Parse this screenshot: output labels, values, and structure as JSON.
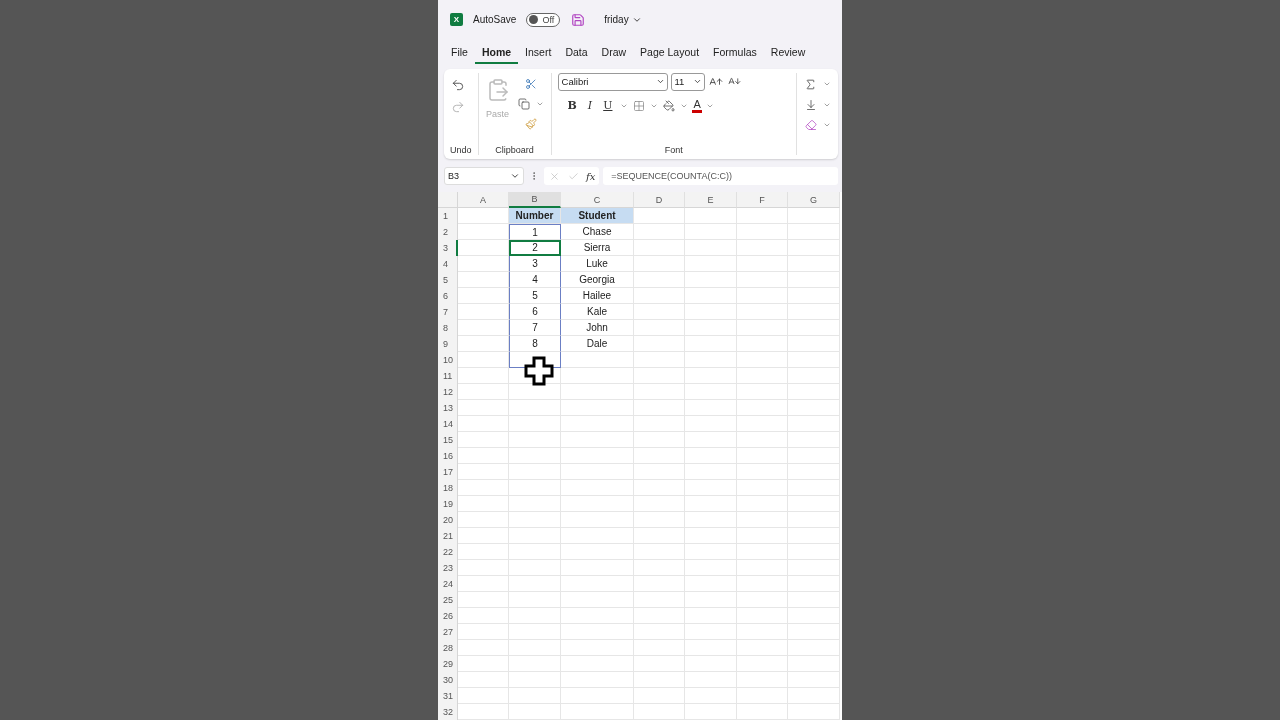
{
  "title_bar": {
    "logo": "X",
    "autosave_label": "AutoSave",
    "autosave": {
      "on": false,
      "label": "Off"
    },
    "file_name": "friday"
  },
  "ribbon_tabs": [
    {
      "label": "File",
      "selected": false
    },
    {
      "label": "Home",
      "selected": true
    },
    {
      "label": "Insert",
      "selected": false
    },
    {
      "label": "Data",
      "selected": false
    },
    {
      "label": "Draw",
      "selected": false
    },
    {
      "label": "Page Layout",
      "selected": false
    },
    {
      "label": "Formulas",
      "selected": false
    },
    {
      "label": "Review",
      "selected": false
    }
  ],
  "ribbon": {
    "undo_group": "Undo",
    "clipboard_group": "Clipboard",
    "font_group": "Font",
    "paste_label": "Paste",
    "font_name": "Calibri",
    "font_size": "11",
    "bold": "B",
    "italic": "I",
    "underline": "U",
    "font_color": "A"
  },
  "formula_bar": {
    "name_box": "B3",
    "fx": "fx",
    "formula": "=SEQUENCE(COUNTA(C:C))"
  },
  "columns": [
    {
      "label": "A",
      "selected": false
    },
    {
      "label": "B",
      "selected": true
    },
    {
      "label": "C",
      "selected": false
    },
    {
      "label": "D",
      "selected": false
    },
    {
      "label": "E",
      "selected": false
    },
    {
      "label": "F",
      "selected": false
    },
    {
      "label": "G",
      "selected": false
    }
  ],
  "rows": [
    {
      "label": "1",
      "kind": "header",
      "selected": false,
      "in_range": false,
      "b": "Number",
      "c": "Student"
    },
    {
      "label": "2",
      "kind": "data",
      "selected": false,
      "in_range": true,
      "b": "1",
      "c": "Chase"
    },
    {
      "label": "3",
      "kind": "data",
      "selected": true,
      "in_range": true,
      "b": "2",
      "c": "Sierra"
    },
    {
      "label": "4",
      "kind": "data",
      "selected": false,
      "in_range": true,
      "b": "3",
      "c": "Luke"
    },
    {
      "label": "5",
      "kind": "data",
      "selected": false,
      "in_range": true,
      "b": "4",
      "c": "Georgia"
    },
    {
      "label": "6",
      "kind": "data",
      "selected": false,
      "in_range": true,
      "b": "5",
      "c": "Hailee"
    },
    {
      "label": "7",
      "kind": "data",
      "selected": false,
      "in_range": true,
      "b": "6",
      "c": "Kale"
    },
    {
      "label": "8",
      "kind": "data",
      "selected": false,
      "in_range": true,
      "b": "7",
      "c": "John"
    },
    {
      "label": "9",
      "kind": "data",
      "selected": false,
      "in_range": true,
      "b": "8",
      "c": "Dale"
    },
    {
      "label": "10",
      "kind": "data",
      "selected": false,
      "in_range": true
    },
    {
      "label": "11",
      "kind": "data",
      "selected": false,
      "in_range": false
    },
    {
      "label": "12",
      "kind": "data",
      "selected": false,
      "in_range": false
    },
    {
      "label": "13",
      "kind": "data",
      "selected": false,
      "in_range": false
    },
    {
      "label": "14",
      "kind": "data",
      "selected": false,
      "in_range": false
    },
    {
      "label": "15",
      "kind": "data",
      "selected": false,
      "in_range": false
    },
    {
      "label": "16",
      "kind": "data",
      "selected": false,
      "in_range": false
    },
    {
      "label": "17",
      "kind": "data",
      "selected": false,
      "in_range": false
    },
    {
      "label": "18",
      "kind": "data",
      "selected": false,
      "in_range": false
    },
    {
      "label": "19",
      "kind": "data",
      "selected": false,
      "in_range": false
    },
    {
      "label": "20",
      "kind": "data",
      "selected": false,
      "in_range": false
    },
    {
      "label": "21",
      "kind": "data",
      "selected": false,
      "in_range": false
    },
    {
      "label": "22",
      "kind": "data",
      "selected": false,
      "in_range": false
    },
    {
      "label": "23",
      "kind": "data",
      "selected": false,
      "in_range": false
    },
    {
      "label": "24",
      "kind": "data",
      "selected": false,
      "in_range": false
    },
    {
      "label": "25",
      "kind": "data",
      "selected": false,
      "in_range": false
    },
    {
      "label": "26",
      "kind": "data",
      "selected": false,
      "in_range": false
    },
    {
      "label": "27",
      "kind": "data",
      "selected": false,
      "in_range": false
    },
    {
      "label": "28",
      "kind": "data",
      "selected": false,
      "in_range": false
    },
    {
      "label": "29",
      "kind": "data",
      "selected": false,
      "in_range": false
    },
    {
      "label": "30",
      "kind": "data",
      "selected": false,
      "in_range": false
    },
    {
      "label": "31",
      "kind": "data",
      "selected": false,
      "in_range": false
    },
    {
      "label": "32",
      "kind": "data",
      "selected": false,
      "in_range": false
    }
  ]
}
